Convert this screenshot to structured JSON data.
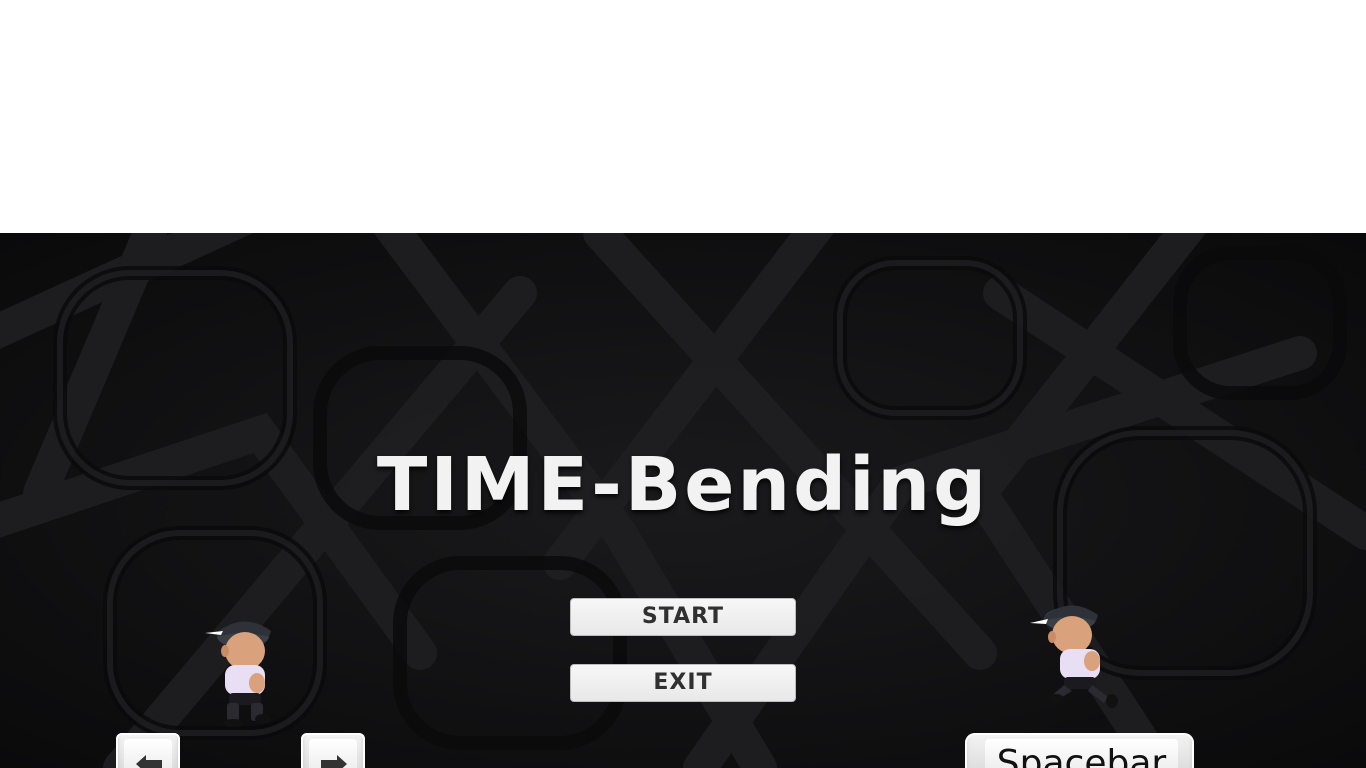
{
  "game": {
    "title": "TIME-Bending",
    "menu": {
      "start_label": "START",
      "exit_label": "EXIT"
    },
    "controls": {
      "left_key_icon": "left-arrow-icon",
      "right_key_icon": "right-arrow-icon",
      "jump_key_label": "Spacebar"
    }
  },
  "colors": {
    "background": "#101012",
    "title": "#f2f2f2",
    "button_bg": "#f2f2f2",
    "button_text": "#303030"
  }
}
